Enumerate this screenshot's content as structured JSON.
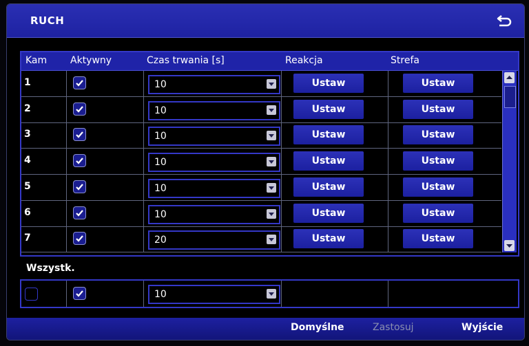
{
  "window": {
    "title": "RUCH"
  },
  "table": {
    "headers": [
      "Kam",
      "Aktywny",
      "Czas trwania [s]",
      "Reakcja",
      "Strefa"
    ],
    "rows": [
      {
        "cam": "1",
        "active": true,
        "duration": "10",
        "reaction": "Ustaw",
        "zone": "Ustaw"
      },
      {
        "cam": "2",
        "active": true,
        "duration": "10",
        "reaction": "Ustaw",
        "zone": "Ustaw"
      },
      {
        "cam": "3",
        "active": true,
        "duration": "10",
        "reaction": "Ustaw",
        "zone": "Ustaw"
      },
      {
        "cam": "4",
        "active": true,
        "duration": "10",
        "reaction": "Ustaw",
        "zone": "Ustaw"
      },
      {
        "cam": "5",
        "active": true,
        "duration": "10",
        "reaction": "Ustaw",
        "zone": "Ustaw"
      },
      {
        "cam": "6",
        "active": true,
        "duration": "10",
        "reaction": "Ustaw",
        "zone": "Ustaw"
      },
      {
        "cam": "7",
        "active": true,
        "duration": "20",
        "reaction": "Ustaw",
        "zone": "Ustaw"
      }
    ]
  },
  "all": {
    "label": "Wszystk.",
    "select_checked": false,
    "active": true,
    "duration": "10"
  },
  "footer": {
    "default_label": "Domyślne",
    "apply_label": "Zastosuj",
    "exit_label": "Wyjście"
  },
  "colors": {
    "accent": "#1f23a8",
    "border": "#3438c8",
    "disabled_text": "#8a8fb0"
  },
  "icons": {
    "back": "return-arrow-icon",
    "check": "check-icon",
    "dropdown": "chevron-down-icon"
  }
}
